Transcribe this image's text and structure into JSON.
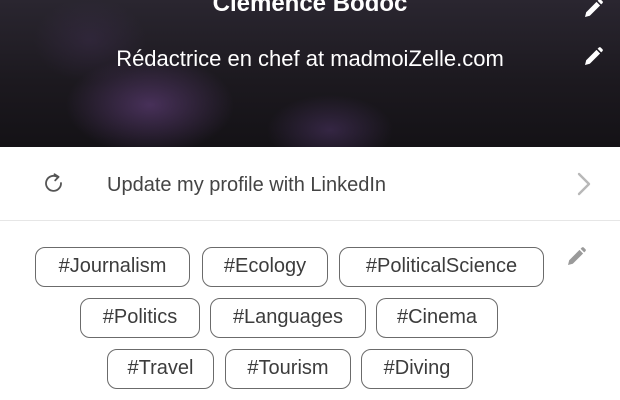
{
  "profile": {
    "name": "Clemence Bodoc",
    "title": "Rédactrice en chef at madmoiZelle.com"
  },
  "linkedin": {
    "label": "Update my profile with LinkedIn"
  },
  "tags": [
    "#Journalism",
    "#Ecology",
    "#PoliticalScience",
    "#Politics",
    "#Languages",
    "#Cinema",
    "#Travel",
    "#Tourism",
    "#Diving"
  ],
  "colors": {
    "header_bg": "#1c191f",
    "tag_border": "#6b6b6b",
    "icon_gray": "#9a9a9a"
  },
  "icons": {
    "edit": "pencil-icon",
    "refresh": "refresh-icon",
    "navigate": "chevron-right-icon"
  }
}
